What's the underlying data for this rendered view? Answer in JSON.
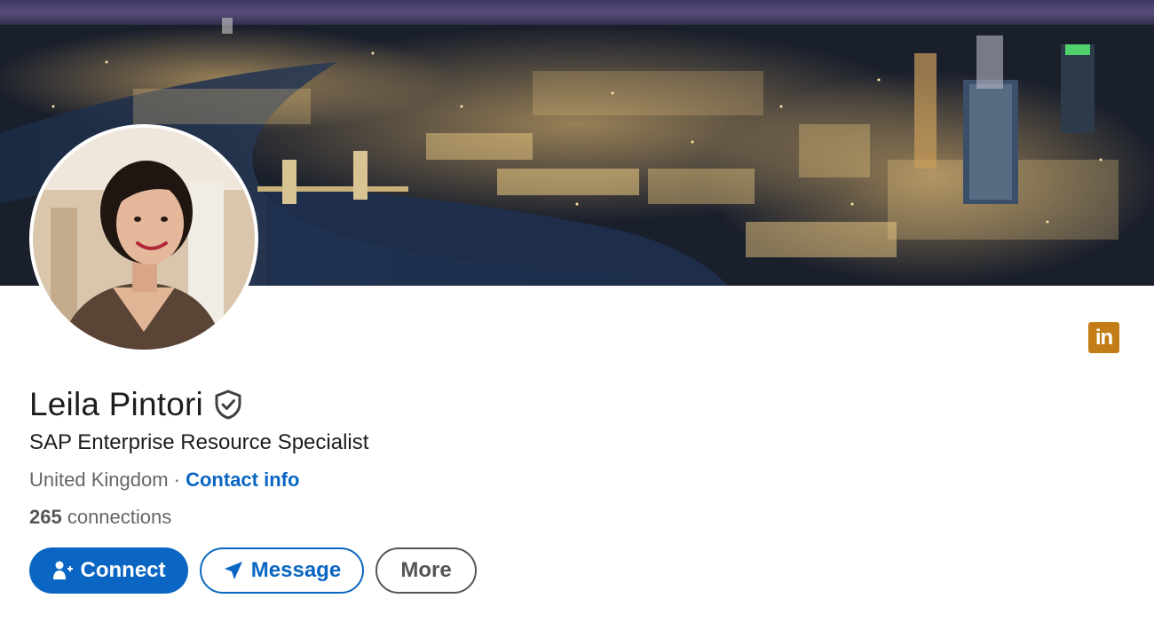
{
  "profile": {
    "name": "Leila Pintori",
    "headline": "SAP Enterprise Resource Specialist",
    "location": "United Kingdom",
    "separator": " · ",
    "contact_info_label": "Contact info",
    "connections_count": "265",
    "connections_label": " connections"
  },
  "actions": {
    "connect_label": "Connect",
    "message_label": "Message",
    "more_label": "More"
  },
  "brand": {
    "logo_text": "in",
    "logo_color": "#c37d16"
  },
  "icons": {
    "verified": "shield-check-icon",
    "connect": "add-person-icon",
    "message": "paper-plane-icon"
  },
  "colors": {
    "primary": "#0a66c2",
    "text": "#1d1d1d",
    "muted": "#666666"
  }
}
